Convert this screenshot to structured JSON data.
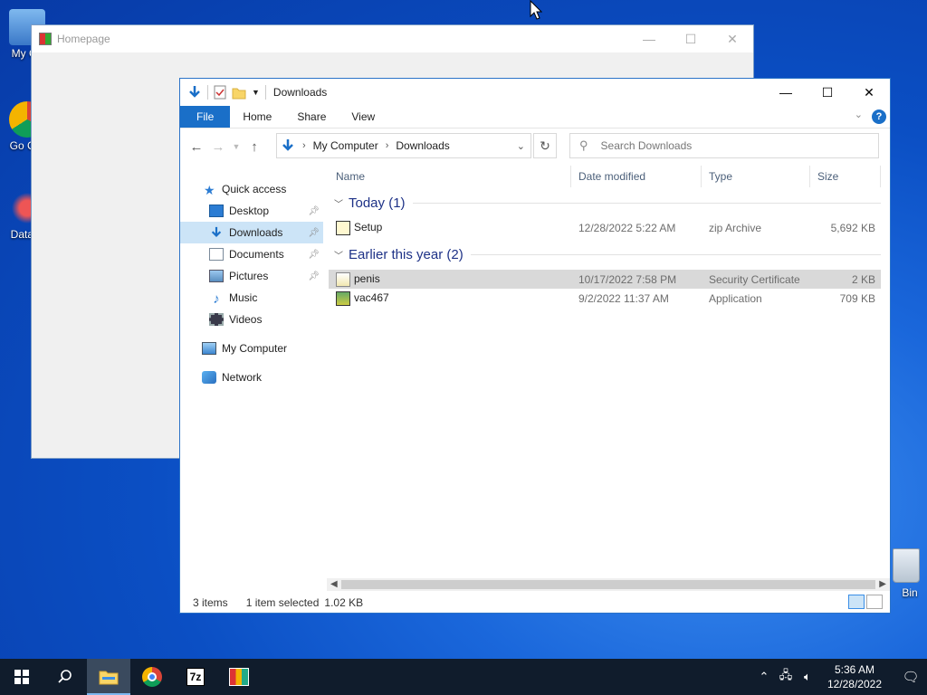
{
  "desktop": {
    "icons": [
      {
        "label": "My Co",
        "icon": "computer-icon"
      },
      {
        "label": "Go Chr",
        "icon": "chrome-icon"
      },
      {
        "label": "DataW",
        "icon": "datawiz-icon"
      }
    ],
    "recycle_bin_label": "Bin"
  },
  "bg_window": {
    "title": "Homepage",
    "minimize": "—",
    "maximize": "☐",
    "close": "✕"
  },
  "explorer": {
    "title": "Downloads",
    "controls": {
      "minimize": "—",
      "maximize": "☐",
      "close": "✕"
    },
    "ribbon_tabs": [
      "File",
      "Home",
      "Share",
      "View"
    ],
    "help_label": "?",
    "address": {
      "root": "My Computer",
      "current": "Downloads"
    },
    "search_placeholder": "Search Downloads",
    "nav_pane": {
      "quick_access": "Quick access",
      "items": [
        "Desktop",
        "Downloads",
        "Documents",
        "Pictures",
        "Music",
        "Videos"
      ],
      "my_computer": "My Computer",
      "network": "Network"
    },
    "columns": [
      "Name",
      "Date modified",
      "Type",
      "Size"
    ],
    "groups": [
      {
        "label": "Today (1)",
        "files": [
          {
            "name": "Setup",
            "date": "12/28/2022 5:22 AM",
            "type": "zip Archive",
            "size": "5,692 KB",
            "icon": "zip-archive-icon"
          }
        ]
      },
      {
        "label": "Earlier this year (2)",
        "files": [
          {
            "name": "penis",
            "date": "10/17/2022 7:58 PM",
            "type": "Security Certificate",
            "size": "2 KB",
            "icon": "certificate-icon"
          },
          {
            "name": "vac467",
            "date": "9/2/2022 11:37 AM",
            "type": "Application",
            "size": "709 KB",
            "icon": "application-icon"
          }
        ]
      }
    ],
    "status": {
      "items": "3 items",
      "selected": "1 item selected",
      "size": "1.02 KB"
    }
  },
  "taskbar": {
    "apps": [
      "file-explorer-icon",
      "chrome-icon",
      "7zip-icon",
      "app-icon"
    ],
    "seven_zip_label": "7z",
    "clock_time": "5:36 AM",
    "clock_date": "12/28/2022"
  },
  "colors": {
    "accent": "#1a6fc8",
    "selection": "#cce4f7",
    "group_header": "#1e3287"
  }
}
